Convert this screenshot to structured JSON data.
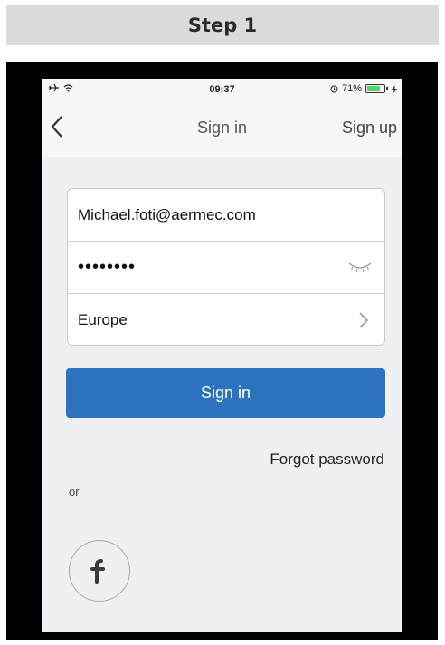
{
  "step": {
    "label": "Step 1"
  },
  "statusbar": {
    "time": "09:37",
    "battery": "71%"
  },
  "navbar": {
    "title": "Sign in",
    "signup_label": "Sign up"
  },
  "form": {
    "email_value": "Michael.foti@aermec.com",
    "password_masked": "••••••••",
    "region_value": "Europe"
  },
  "signin_label": "Sign in",
  "forgot_label": "Forgot password",
  "or_label": "or",
  "colors": {
    "primary": "#2c72bd",
    "screen_bg": "#eff0f4",
    "frame": "#000000"
  },
  "icons": [
    "airplane-icon",
    "wifi-icon",
    "alarm-icon",
    "battery-icon",
    "charging-icon",
    "back-chevron-icon",
    "eye-closed-icon",
    "chevron-right-icon",
    "facebook-icon"
  ]
}
